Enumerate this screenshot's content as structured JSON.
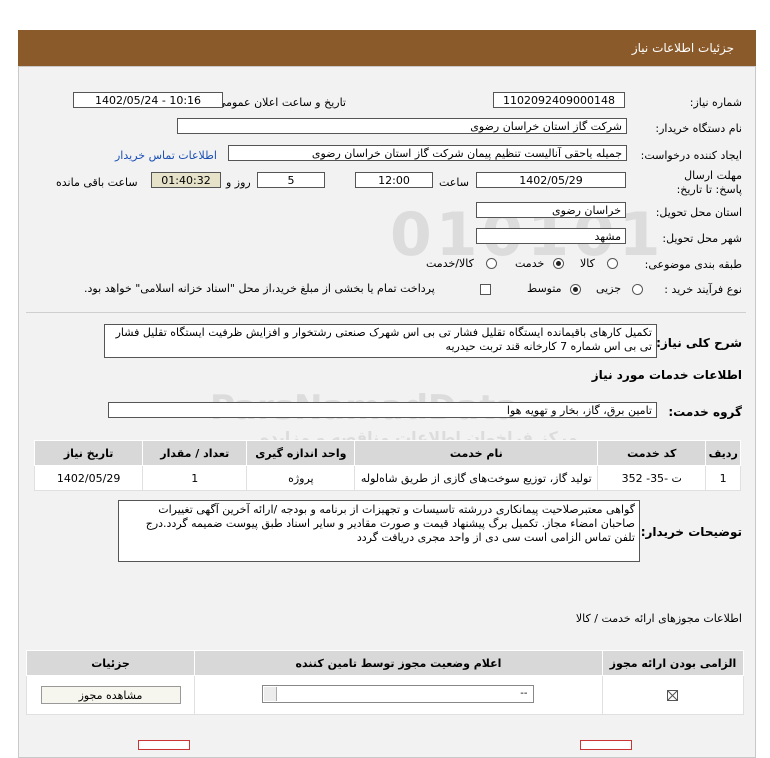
{
  "header": {
    "title": "جزئیات اطلاعات نیاز"
  },
  "form": {
    "need_number_label": "شماره نیاز:",
    "need_number": "1102092409000148",
    "announce_label": "تاریخ و ساعت اعلان عمومی:",
    "announce_value": "1402/05/24 - 10:16",
    "buyer_org_label": "نام دستگاه خریدار:",
    "buyer_org": "شرکت گاز استان خراسان رضوی",
    "requester_label": "ایجاد کننده درخواست:",
    "requester": "جمیله یاحقی آنالیست تنظیم پیمان  شرکت گاز استان خراسان رضوی",
    "buyer_contact_link": "اطلاعات تماس خریدار",
    "deadline_label": "مهلت ارسال پاسخ: تا تاریخ:",
    "deadline_date": "1402/05/29",
    "time_label": "ساعت",
    "deadline_time": "12:00",
    "days_value": "5",
    "days_label": "روز و",
    "remaining_time": "01:40:32",
    "remaining_label": "ساعت باقی مانده",
    "province_label": "استان محل تحویل:",
    "province": "خراسان رضوی",
    "city_label": "شهر محل تحویل:",
    "city": "مشهد",
    "category_label": "طبقه بندی موضوعی:",
    "category_options": [
      "کالا",
      "خدمت",
      "کالا/خدمت"
    ],
    "category_selected": "خدمت",
    "process_label": "نوع فرآیند خرید :",
    "process_options": [
      "جزیی",
      "متوسط"
    ],
    "process_selected": "متوسط",
    "payment_note": "پرداخت تمام یا بخشی از مبلغ خرید،از محل \"اسناد خزانه اسلامی\" خواهد بود."
  },
  "summary": {
    "label": "شرح کلی نیاز:",
    "text": "تکمیل کارهای باقیمانده ایستگاه تقلیل فشار تی بی اس شهرک صنعتی رشتخوار و افزایش ظرفیت ایستگاه تقلیل فشار تی بی اس شماره 7 کارخانه قند تربت حیدریه"
  },
  "services": {
    "section_title": "اطلاعات خدمات مورد نیاز",
    "group_label": "گروه خدمت:",
    "group_value": "تامین برق، گاز، بخار و تهویه هوا",
    "columns": [
      "ردیف",
      "کد خدمت",
      "نام خدمت",
      "واحد اندازه گیری",
      "تعداد / مقدار",
      "تاریخ نیاز"
    ],
    "rows": [
      [
        "1",
        "ت -35- 352",
        "تولید گاز، توزیع سوخت‌های گازی از طریق شاه‌لوله",
        "پروژه",
        "1",
        "1402/05/29"
      ]
    ]
  },
  "buyer_notes": {
    "label": "توضیحات خریدار:",
    "text": "گواهی معتبرصلاحیت پیمانکاری دررشته تاسیسات و تجهیزات از برنامه و بودجه /ارائه آخرین آگهی تغییرات صاحبان امضاء مجاز. تکمیل برگ پیشنهاد قیمت و صورت مقادیر و سایر اسناد طبق پیوست ضمیمه گردد.درج تلفن تماس الزامی  است سی دی از واحد مجری دریافت گردد"
  },
  "permits": {
    "section_title": "اطلاعات مجوزهای ارائه خدمت / کالا",
    "columns": [
      "الزامی بودن ارائه مجوز",
      "اعلام وضعیت مجوز توسط تامین کننده",
      "جزئیات"
    ],
    "select_value": "--",
    "view_button": "مشاهده مجوز"
  },
  "watermark": {
    "line1": "ParsNamadData",
    "line2": "مرکز فراخوان اطلاعات مناقصه و مزایده"
  },
  "colors": {
    "header_bg": "#8b5a2b",
    "panel_bg": "#f2f2f2",
    "link": "#1a4fb5"
  }
}
